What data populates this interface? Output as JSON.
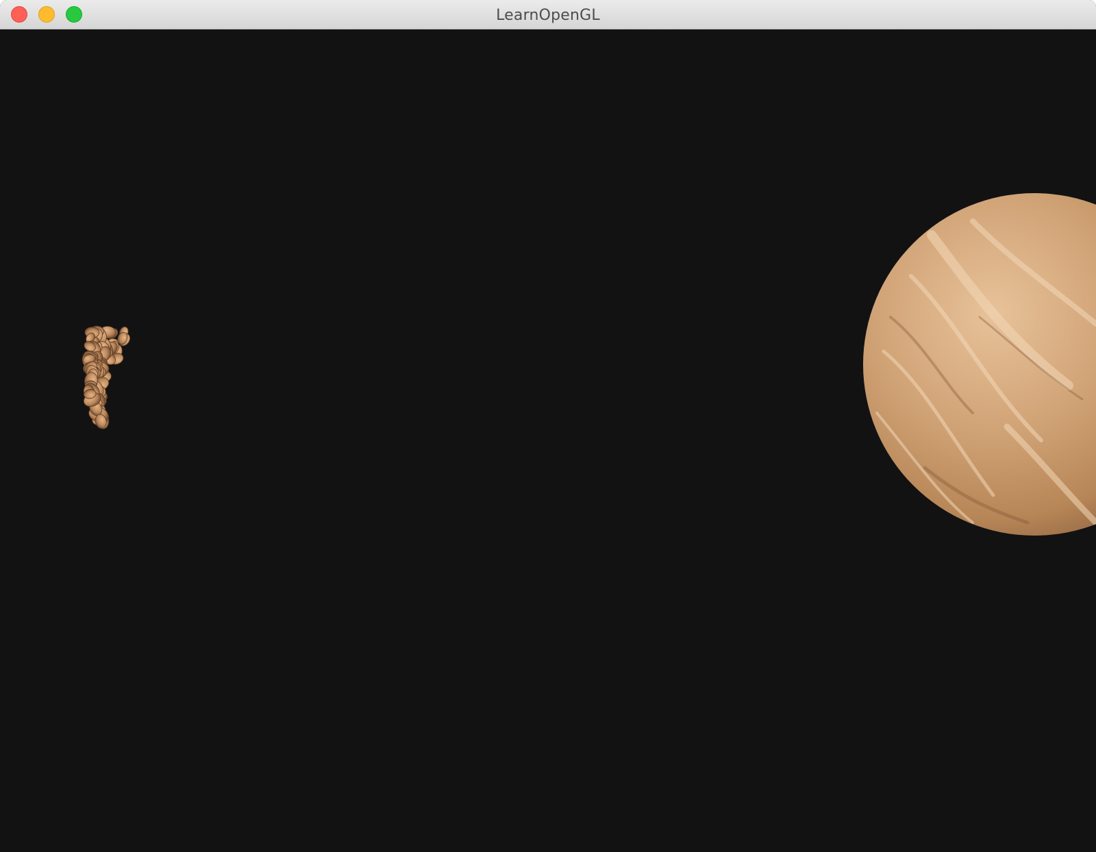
{
  "window": {
    "title": "LearnOpenGL",
    "controls": {
      "close": "close-button",
      "minimize": "minimize-button",
      "zoom": "zoom-button"
    }
  },
  "scene": {
    "background_color": "#121213",
    "planet_color": "#c99a6c",
    "rock_color": "#b8865d",
    "objects": [
      "planet",
      "asteroid-ring"
    ]
  }
}
